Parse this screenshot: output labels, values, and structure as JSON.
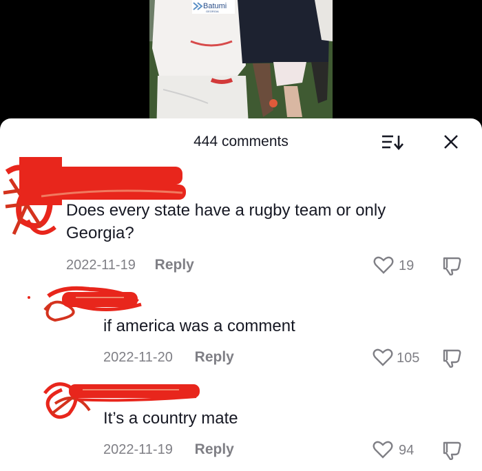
{
  "video": {
    "jersey_text": "Batumi",
    "jersey_subtext": "GEORGIA"
  },
  "header": {
    "title": "444 comments"
  },
  "comments": [
    {
      "text": "Does every state have a rugby team or only Georgia?",
      "date": "2022-11-19",
      "reply_label": "Reply",
      "likes": "19",
      "level": "top"
    },
    {
      "text": "if america was a comment",
      "date": "2022-11-20",
      "reply_label": "Reply",
      "likes": "105",
      "level": "reply"
    },
    {
      "text": "It’s a country mate",
      "date": "2022-11-19",
      "reply_label": "Reply",
      "likes": "94",
      "level": "reply"
    }
  ],
  "colors": {
    "text": "#161823",
    "secondary": "#7f7f85",
    "redaction": "#e8261c",
    "background": "#ffffff"
  },
  "icons": {
    "sort": "sort-icon",
    "close": "close-icon",
    "like": "heart-outline-icon",
    "dislike": "thumbs-down-icon"
  }
}
